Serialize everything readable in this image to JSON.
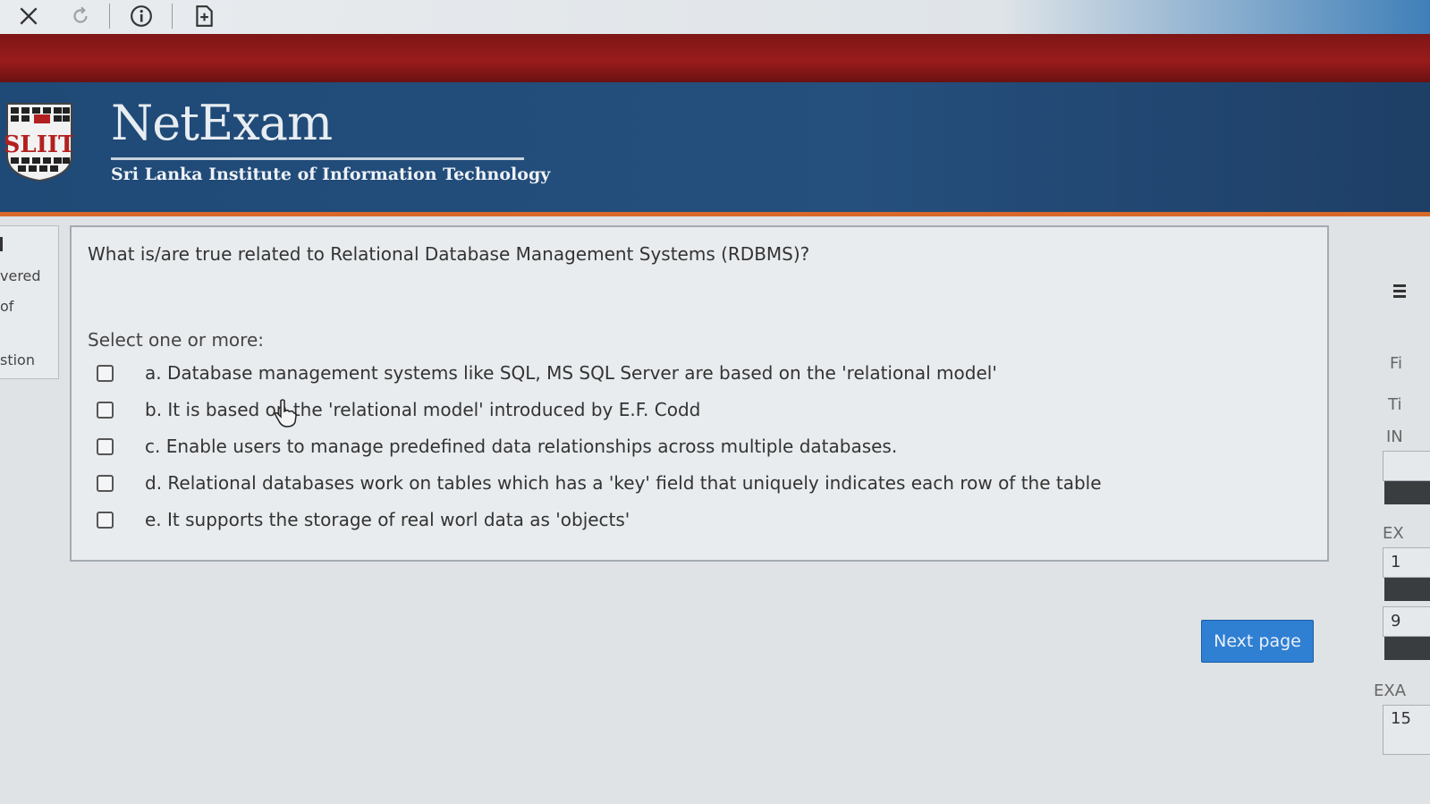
{
  "browser": {
    "icons": [
      "close-icon",
      "reload-icon",
      "info-icon",
      "add-page-icon"
    ]
  },
  "header": {
    "logo_text": "SLIIT",
    "brand": "NetExam",
    "subtitle": "Sri Lanka Institute of Information Technology"
  },
  "left_nav": {
    "lines": [
      "vered",
      "of",
      "stion"
    ]
  },
  "question": {
    "text": "What is/are true related to Relational Database Management Systems (RDBMS)?",
    "prompt": "Select one or more:",
    "options": [
      {
        "label": "a. Database management systems like SQL, MS SQL Server are based on the 'relational model'",
        "checked": false
      },
      {
        "label": "b. It is based on the 'relational model' introduced by E.F. Codd",
        "checked": false
      },
      {
        "label": "c. Enable users to manage predefined data relationships across multiple databases.",
        "checked": false
      },
      {
        "label": "d. Relational databases work on tables which has a 'key' field that uniquely indicates each row of the table",
        "checked": false
      },
      {
        "label": "e. It supports the storage of real worl data as 'objects'",
        "checked": false
      }
    ]
  },
  "next_button": "Next page",
  "right_panel": {
    "labels": [
      "Fi",
      "Ti",
      "IN",
      "EX",
      "EXA"
    ],
    "values": [
      "1",
      "9",
      "15"
    ]
  },
  "colors": {
    "header_blue": "#254f7d",
    "band_red": "#9a1b1b",
    "accent_orange": "#d8692a",
    "button_blue": "#2f7fd3"
  }
}
